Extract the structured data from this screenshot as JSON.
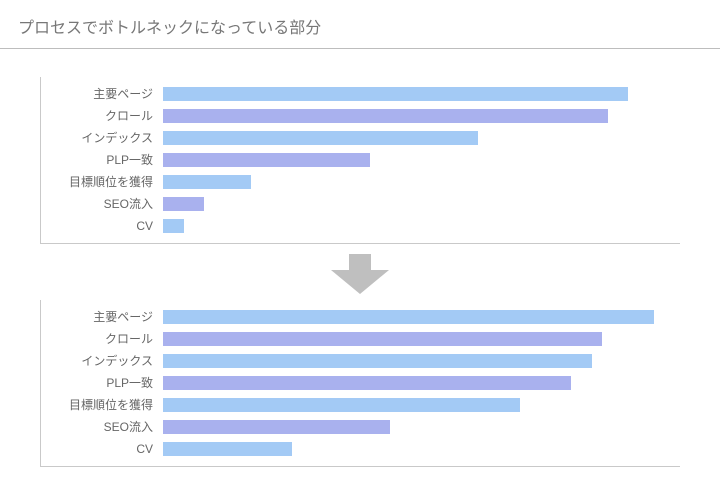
{
  "title": "プロセスでボトルネックになっている部分",
  "colors": {
    "blue": "#a3caf5",
    "violet": "#a9b1ee",
    "arrow": "#bfbfbf"
  },
  "chart_data": [
    {
      "type": "bar",
      "orientation": "horizontal",
      "xlim": [
        0,
        100
      ],
      "categories": [
        "主要ページ",
        "クロール",
        "インデックス",
        "PLP一致",
        "目標順位を獲得",
        "SEO流入",
        "CV"
      ],
      "values": [
        90,
        86,
        61,
        40,
        17,
        8,
        4
      ],
      "colors": [
        "blue",
        "violet",
        "blue",
        "violet",
        "blue",
        "violet",
        "blue"
      ]
    },
    {
      "type": "bar",
      "orientation": "horizontal",
      "xlim": [
        0,
        100
      ],
      "categories": [
        "主要ページ",
        "クロール",
        "インデックス",
        "PLP一致",
        "目標順位を獲得",
        "SEO流入",
        "CV"
      ],
      "values": [
        95,
        85,
        83,
        79,
        69,
        44,
        25
      ],
      "colors": [
        "blue",
        "violet",
        "blue",
        "violet",
        "blue",
        "violet",
        "blue"
      ]
    }
  ]
}
